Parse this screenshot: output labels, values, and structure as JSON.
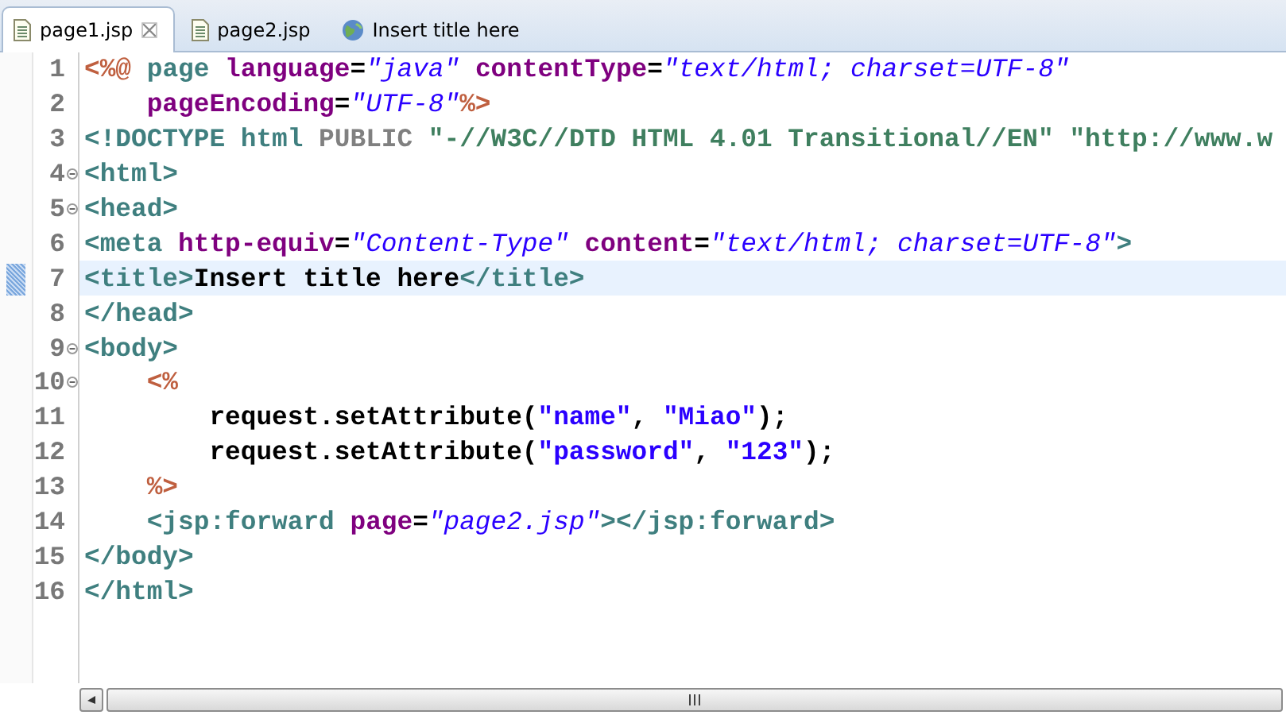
{
  "tabs": [
    {
      "label": "page1.jsp",
      "selected": true,
      "kind": "file",
      "closable": true
    },
    {
      "label": "page2.jsp",
      "selected": false,
      "kind": "file",
      "closable": false
    },
    {
      "label": "Insert title here",
      "selected": false,
      "kind": "web",
      "closable": false
    }
  ],
  "editor": {
    "lines": [
      {
        "number": "1",
        "foldable": false,
        "current": false,
        "tokens": [
          {
            "kind": "jsp",
            "text": "<%@"
          },
          {
            "kind": "tag",
            "text": " page"
          },
          {
            "kind": "attr",
            "text": " language"
          },
          {
            "kind": "text",
            "text": "="
          },
          {
            "kind": "value",
            "text": "\"java\""
          },
          {
            "kind": "attr",
            "text": " contentType"
          },
          {
            "kind": "text",
            "text": "="
          },
          {
            "kind": "value",
            "text": "\"text/html; charset=UTF-8\""
          }
        ]
      },
      {
        "number": "2",
        "foldable": false,
        "current": false,
        "tokens": [
          {
            "kind": "attr",
            "text": "    pageEncoding"
          },
          {
            "kind": "text",
            "text": "="
          },
          {
            "kind": "value",
            "text": "\"UTF-8\""
          },
          {
            "kind": "jsp",
            "text": "%>"
          }
        ]
      },
      {
        "number": "3",
        "foldable": false,
        "current": false,
        "tokens": [
          {
            "kind": "tag",
            "text": "<!DOCTYPE"
          },
          {
            "kind": "tag",
            "text": " html"
          },
          {
            "kind": "doctype",
            "text": " PUBLIC"
          },
          {
            "kind": "doctype_string",
            "text": " \"-//W3C//DTD HTML 4.01 Transitional//EN\""
          },
          {
            "kind": "doctype_string",
            "text": " \"http://www.w"
          }
        ]
      },
      {
        "number": "4",
        "foldable": true,
        "current": false,
        "tokens": [
          {
            "kind": "tag",
            "text": "<html>"
          }
        ]
      },
      {
        "number": "5",
        "foldable": true,
        "current": false,
        "tokens": [
          {
            "kind": "tag",
            "text": "<head>"
          }
        ]
      },
      {
        "number": "6",
        "foldable": false,
        "current": false,
        "tokens": [
          {
            "kind": "tag",
            "text": "<meta"
          },
          {
            "kind": "attr",
            "text": " http-equiv"
          },
          {
            "kind": "text",
            "text": "="
          },
          {
            "kind": "value",
            "text": "\"Content-Type\""
          },
          {
            "kind": "attr",
            "text": " content"
          },
          {
            "kind": "text",
            "text": "="
          },
          {
            "kind": "value",
            "text": "\"text/html; charset=UTF-8\""
          },
          {
            "kind": "tag",
            "text": ">"
          }
        ]
      },
      {
        "number": "7",
        "foldable": false,
        "current": true,
        "tokens": [
          {
            "kind": "tag",
            "text": "<title>"
          },
          {
            "kind": "text",
            "text": "Insert title here"
          },
          {
            "kind": "tag",
            "text": "</title>"
          }
        ]
      },
      {
        "number": "8",
        "foldable": false,
        "current": false,
        "tokens": [
          {
            "kind": "tag",
            "text": "</head>"
          }
        ]
      },
      {
        "number": "9",
        "foldable": true,
        "current": false,
        "tokens": [
          {
            "kind": "tag",
            "text": "<body>"
          }
        ]
      },
      {
        "number": "10",
        "foldable": true,
        "current": false,
        "tokens": [
          {
            "kind": "jsp",
            "text": "    <%"
          }
        ]
      },
      {
        "number": "11",
        "foldable": false,
        "current": false,
        "tokens": [
          {
            "kind": "text",
            "text": "        request.setAttribute("
          },
          {
            "kind": "string",
            "text": "\"name\""
          },
          {
            "kind": "text",
            "text": ", "
          },
          {
            "kind": "string",
            "text": "\"Miao\""
          },
          {
            "kind": "text",
            "text": ");"
          }
        ]
      },
      {
        "number": "12",
        "foldable": false,
        "current": false,
        "tokens": [
          {
            "kind": "text",
            "text": "        request.setAttribute("
          },
          {
            "kind": "string",
            "text": "\"password\""
          },
          {
            "kind": "text",
            "text": ", "
          },
          {
            "kind": "string",
            "text": "\"123\""
          },
          {
            "kind": "text",
            "text": ");"
          }
        ]
      },
      {
        "number": "13",
        "foldable": false,
        "current": false,
        "tokens": [
          {
            "kind": "jsp",
            "text": "    %>"
          }
        ]
      },
      {
        "number": "14",
        "foldable": false,
        "current": false,
        "tokens": [
          {
            "kind": "tag",
            "text": "    <jsp:forward"
          },
          {
            "kind": "attr",
            "text": " page"
          },
          {
            "kind": "text",
            "text": "="
          },
          {
            "kind": "value",
            "text": "\"page2.jsp\""
          },
          {
            "kind": "tag",
            "text": "></jsp:forward>"
          }
        ]
      },
      {
        "number": "15",
        "foldable": false,
        "current": false,
        "tokens": [
          {
            "kind": "tag",
            "text": "</body>"
          }
        ]
      },
      {
        "number": "16",
        "foldable": false,
        "current": false,
        "tokens": [
          {
            "kind": "tag",
            "text": "</html>"
          }
        ]
      }
    ]
  }
}
